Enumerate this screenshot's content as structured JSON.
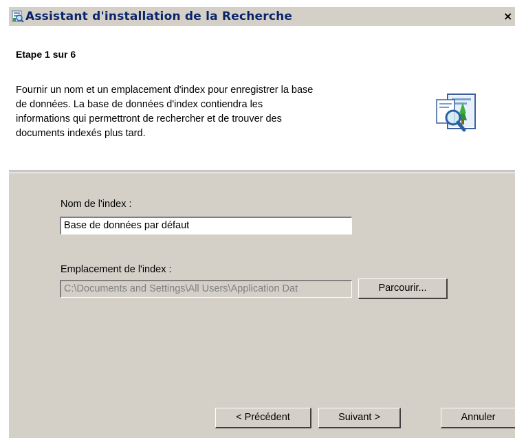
{
  "window": {
    "title": "Assistant d'installation de la Recherche",
    "close_glyph": "×",
    "app_icon": "wizard-app-icon"
  },
  "header": {
    "step": "Etape 1 sur 6",
    "description_lines": [
      "Fournir un nom et un emplacement d'index pour enregistrer la base",
      "de données. La base de données d'index contiendra les",
      "informations qui permettront de rechercher et de trouver des",
      "documents indexés plus tard."
    ],
    "icon": "search-document-icon"
  },
  "form": {
    "index_name_label": "Nom de l'index :",
    "index_name_value": "Base de données par défaut",
    "index_location_label": "Emplacement de l'index :",
    "index_location_value": "C:\\Documents and Settings\\All Users\\Application Dat",
    "browse_label": "Parcourir..."
  },
  "footer": {
    "back_label": "< Précédent",
    "next_label": "Suivant >",
    "cancel_label": "Annuler"
  }
}
